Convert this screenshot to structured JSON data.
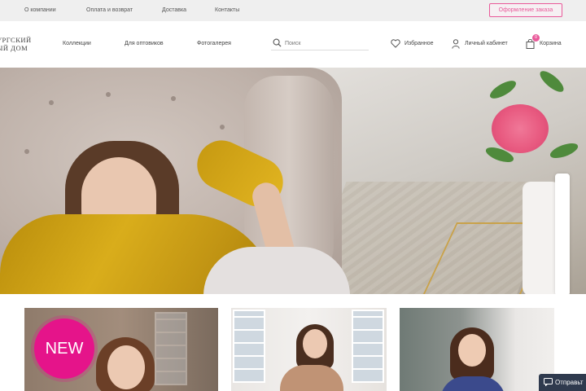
{
  "topbar": {
    "links": [
      "О компании",
      "Оплата и возврат",
      "Доставка",
      "Контакты"
    ],
    "order_button": "Оформление заказа"
  },
  "header": {
    "logo_line1": "ургский",
    "logo_line2": "ый дом",
    "nav": [
      "Коллекции",
      "Для оптовиков",
      "Фотогалерея"
    ],
    "search_placeholder": "Поиск",
    "favorites": "Избранное",
    "account": "Личный кабинет",
    "cart": "Корзина",
    "cart_count": "0"
  },
  "promo": {
    "new_badge": "NEW"
  },
  "chat": {
    "label": "Отправьт"
  },
  "colors": {
    "accent": "#e95a9a",
    "new_badge": "#e5148a",
    "chat_bg": "#2f3a4e",
    "topbar_bg": "#efefef"
  },
  "icons": {
    "search": "search-icon",
    "favorites": "heart-icon",
    "account": "user-icon",
    "cart": "bag-icon",
    "chat": "chat-icon"
  }
}
